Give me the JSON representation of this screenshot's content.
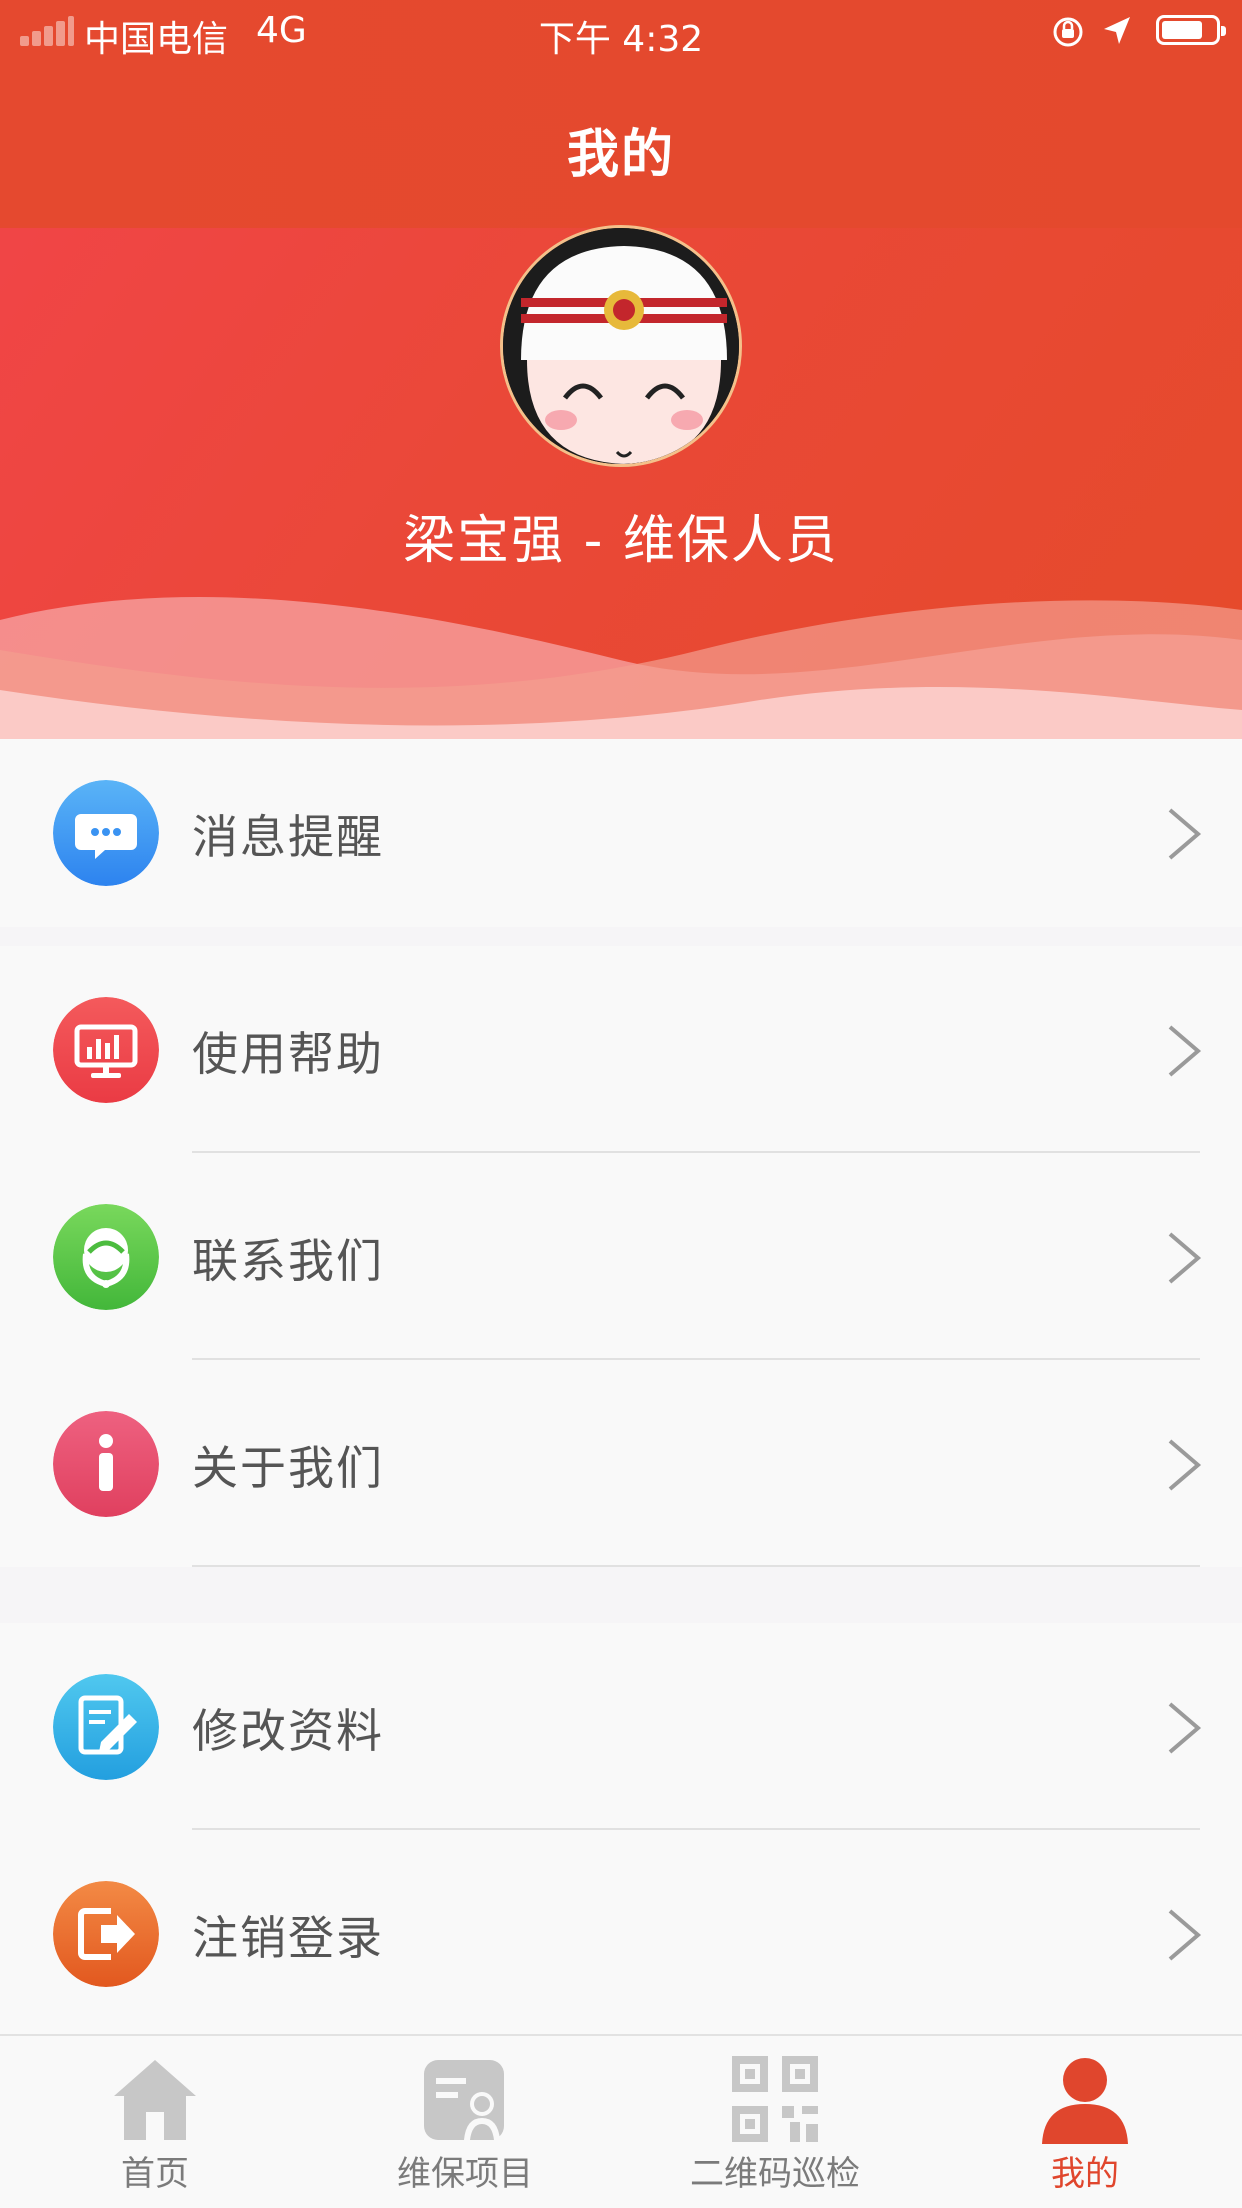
{
  "status_bar": {
    "carrier": "中国电信",
    "network": "4G",
    "time": "下午 4:32"
  },
  "header": {
    "title": "我的"
  },
  "profile": {
    "name_line": "梁宝强 - 维保人员"
  },
  "menu": {
    "group1": [
      {
        "label": "消息提醒",
        "icon": "message-icon",
        "color": "#3f9cf5"
      }
    ],
    "group2": [
      {
        "label": "使用帮助",
        "icon": "monitor-chart-icon",
        "color": "#f0454f"
      },
      {
        "label": "联系我们",
        "icon": "customer-service-icon",
        "color": "#5ecb4a"
      },
      {
        "label": "关于我们",
        "icon": "info-icon",
        "color": "#e8506e"
      }
    ],
    "group3": [
      {
        "label": "修改资料",
        "icon": "edit-icon",
        "color": "#32b0e8"
      },
      {
        "label": "注销登录",
        "icon": "logout-icon",
        "color": "#ec7331"
      }
    ]
  },
  "tabbar": {
    "tabs": [
      {
        "label": "首页",
        "icon": "home-icon",
        "active": false
      },
      {
        "label": "维保项目",
        "icon": "maintenance-icon",
        "active": false
      },
      {
        "label": "二维码巡检",
        "icon": "qr-code-icon",
        "active": false
      },
      {
        "label": "我的",
        "icon": "user-icon",
        "active": true
      }
    ]
  },
  "colors": {
    "brand": "#e5492f",
    "active_tab": "#e0462d"
  }
}
